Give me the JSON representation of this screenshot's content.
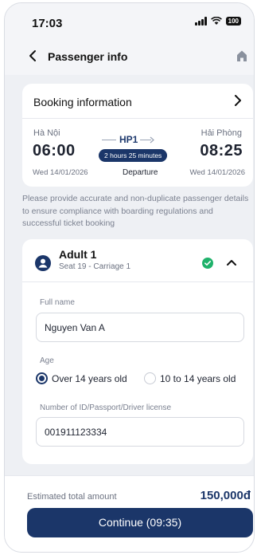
{
  "status_bar": {
    "time": "17:03",
    "battery": "100"
  },
  "header": {
    "title": "Passenger info"
  },
  "booking": {
    "title": "Booking information",
    "from_station": "Hà Nội",
    "to_station": "Hải Phòng",
    "train": "HP1",
    "depart_time": "06:00",
    "arrive_time": "08:25",
    "duration": "2 hours 25 minutes",
    "direction": "Departure",
    "depart_date": "Wed 14/01/2026",
    "arrive_date": "Wed 14/01/2026"
  },
  "notice": "Please provide accurate and non-duplicate passenger details to ensure compliance with boarding regulations and successful ticket booking",
  "passenger": {
    "name": "Adult 1",
    "seat": "Seat 19 - Carriage 1",
    "full_name_label": "Full name",
    "full_name_value": "Nguyen Van A",
    "age_label": "Age",
    "age_options": [
      "Over 14 years old",
      "10 to 14 years old"
    ],
    "age_selected": "Over 14 years old",
    "id_label": "Number of ID/Passport/Driver license",
    "id_value": "001911123334"
  },
  "footer": {
    "estimated_label": "Estimated total amount",
    "amount": "150,000đ",
    "continue_label": "Continue (09:35)"
  },
  "colors": {
    "accent": "#1b3669",
    "success": "#1fb26b",
    "background": "#eef0f4"
  }
}
